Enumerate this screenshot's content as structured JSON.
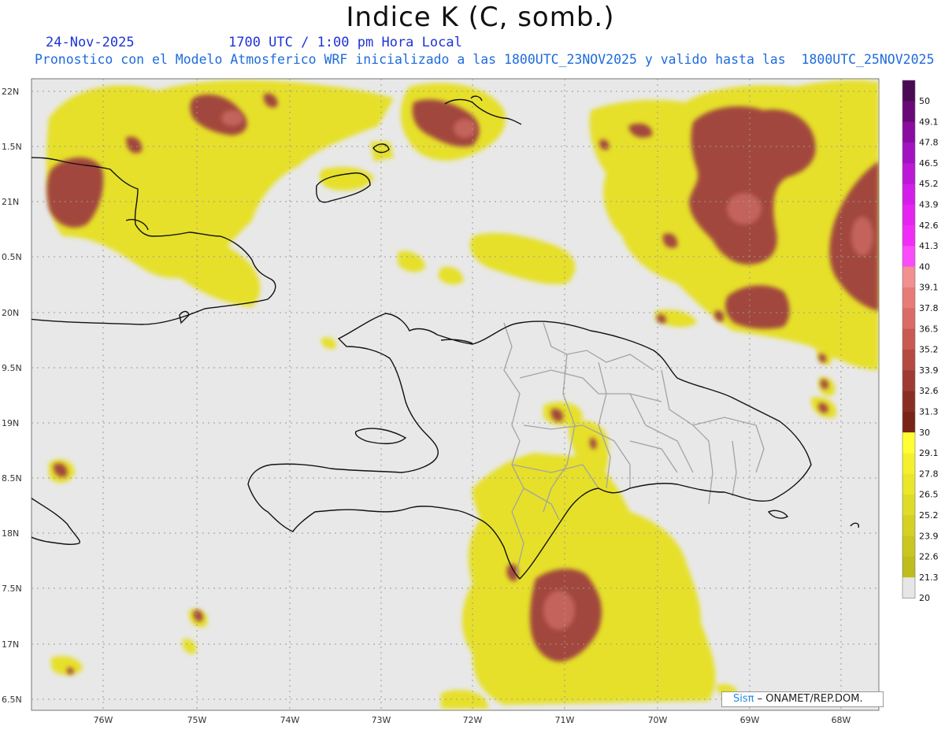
{
  "header": {
    "title": "Indice K (C, somb.)",
    "date": "24-Nov-2025",
    "time": "1700 UTC / 1:00 pm Hora Local",
    "subtitle": "Pronostico con el Modelo Atmosferico WRF inicializado a las 1800UTC_23NOV2025 y valido hasta las  1800UTC_25NOV2025"
  },
  "axes": {
    "lat_labels": [
      "22N",
      "1.5N",
      "21N",
      "0.5N",
      "20N",
      "9.5N",
      "19N",
      "8.5N",
      "18N",
      "7.5N",
      "17N",
      "6.5N"
    ],
    "lon_labels": [
      "76W",
      "75W",
      "74W",
      "73W",
      "72W",
      "71W",
      "70W",
      "69W",
      "68W"
    ]
  },
  "colorbar": {
    "labels": [
      "50",
      "49.1",
      "47.8",
      "46.5",
      "45.2",
      "43.9",
      "42.6",
      "41.3",
      "40",
      "39.1",
      "37.8",
      "36.5",
      "35.2",
      "33.9",
      "32.6",
      "31.3",
      "30",
      "29.1",
      "27.8",
      "26.5",
      "25.2",
      "23.9",
      "22.6",
      "21.3",
      "20"
    ],
    "colors": [
      "#4a0a55",
      "#6a0878",
      "#8a0ca0",
      "#a112c0",
      "#bb18d8",
      "#d21ee8",
      "#e524f0",
      "#f22cf7",
      "#fb4cfb",
      "#f28f8f",
      "#e67b78",
      "#d96c66",
      "#c85a52",
      "#b44a42",
      "#a03b33",
      "#8a2e25",
      "#7a2416",
      "#ffff33",
      "#f5f02e",
      "#eae629",
      "#dedc26",
      "#d4d123",
      "#c9c620",
      "#bfbc1e",
      "#e6e6e6"
    ]
  },
  "credit": {
    "logo": "Sisπ",
    "text": "– ONAMET/REP.DOM."
  }
}
